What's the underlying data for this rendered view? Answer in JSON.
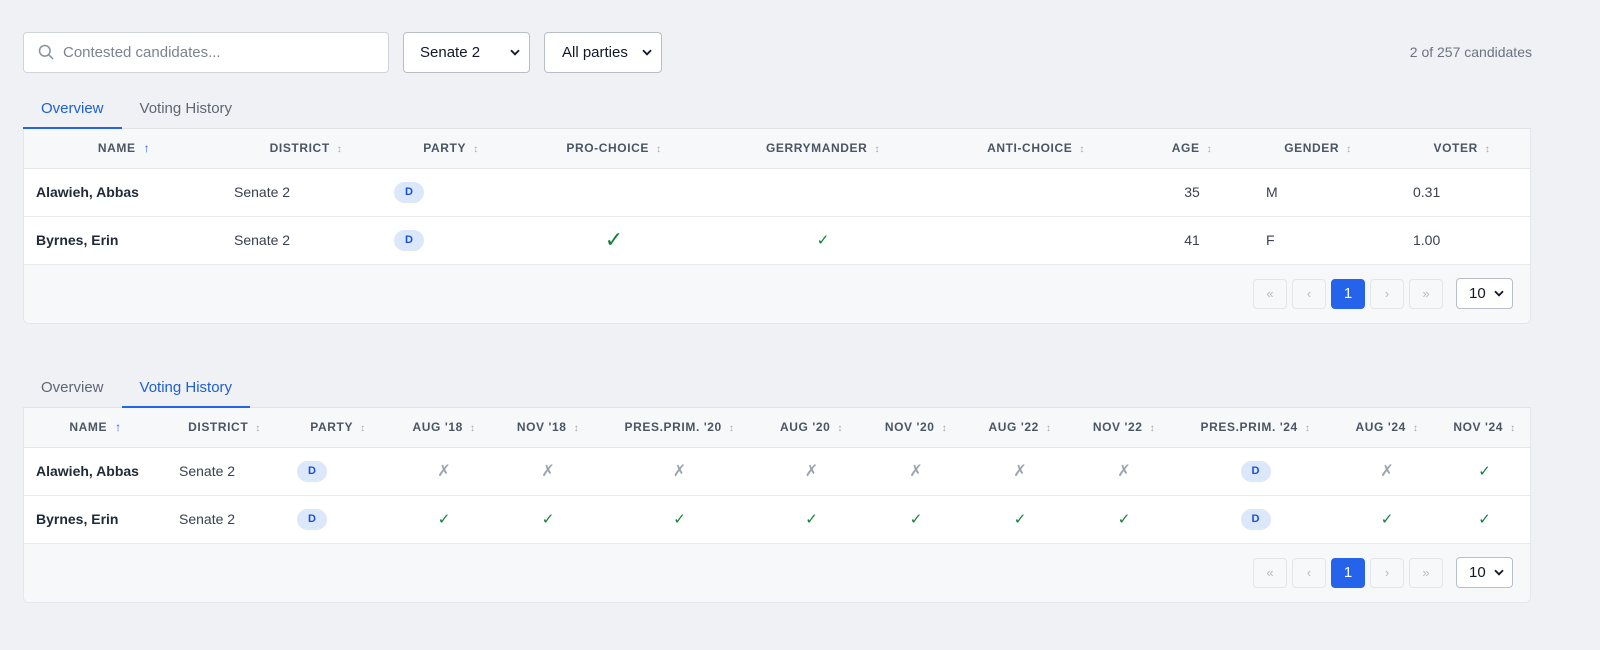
{
  "search": {
    "placeholder": "Contested candidates...",
    "value": ""
  },
  "filters": {
    "district": "Senate 2",
    "party": "All parties"
  },
  "result_count": "2 of 257 candidates",
  "tabs": {
    "overview": "Overview",
    "voting_history": "Voting History"
  },
  "overview_table": {
    "columns": [
      "NAME",
      "DISTRICT",
      "PARTY",
      "PRO-CHOICE",
      "GERRYMANDER",
      "ANTI-CHOICE",
      "AGE",
      "GENDER",
      "VOTER"
    ],
    "rows": [
      {
        "name": "Alawieh, Abbas",
        "district": "Senate 2",
        "party": "D",
        "pro_choice": "",
        "gerrymander": "",
        "anti_choice": "",
        "age": "35",
        "gender": "M",
        "voter": "0.31"
      },
      {
        "name": "Byrnes, Erin",
        "district": "Senate 2",
        "party": "D",
        "pro_choice": "✓",
        "gerrymander": "✓",
        "anti_choice": "",
        "age": "41",
        "gender": "F",
        "voter": "1.00"
      }
    ]
  },
  "history_table": {
    "columns": [
      "NAME",
      "DISTRICT",
      "PARTY",
      "AUG '18",
      "NOV '18",
      "PRES.PRIM. '20",
      "AUG '20",
      "NOV '20",
      "AUG '22",
      "NOV '22",
      "PRES.PRIM. '24",
      "AUG '24",
      "NOV '24"
    ],
    "rows": [
      {
        "name": "Alawieh, Abbas",
        "district": "Senate 2",
        "party": "D",
        "votes": [
          "✗",
          "✗",
          "✗",
          "✗",
          "✗",
          "✗",
          "✗",
          "D",
          "✗",
          "✓"
        ]
      },
      {
        "name": "Byrnes, Erin",
        "district": "Senate 2",
        "party": "D",
        "votes": [
          "✓",
          "✓",
          "✓",
          "✓",
          "✓",
          "✓",
          "✓",
          "D",
          "✓",
          "✓"
        ]
      }
    ]
  },
  "pagination": {
    "first": "«",
    "prev": "‹",
    "current": "1",
    "next": "›",
    "last": "»",
    "page_size": "10"
  },
  "sort": {
    "ascending": "↑",
    "unsorted": "↕"
  },
  "colors": {
    "accent": "#2563eb",
    "check": "#15803d",
    "cross": "#9ca3af",
    "badge_bg": "#dbe7fb"
  }
}
